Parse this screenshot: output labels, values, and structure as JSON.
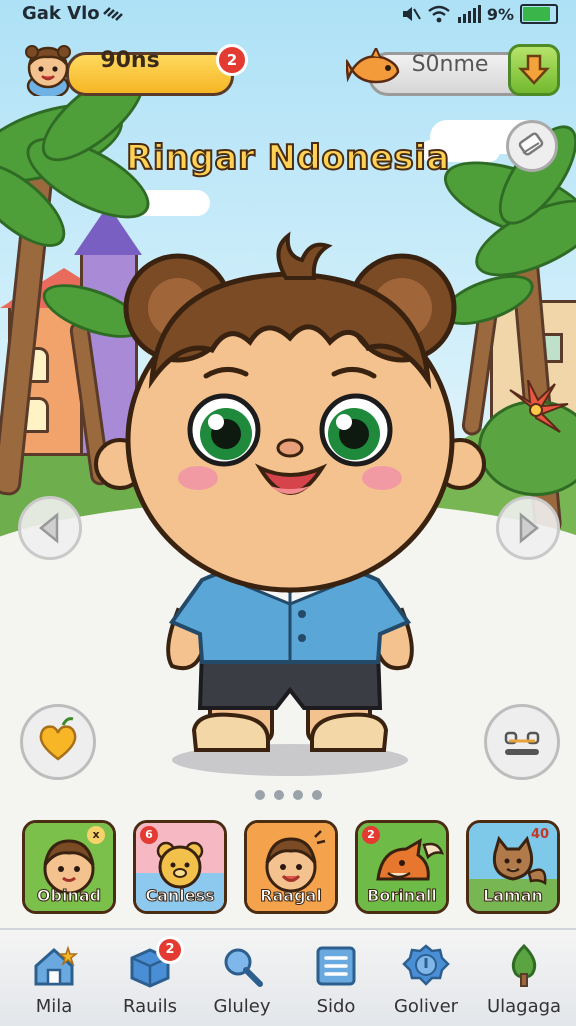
{
  "status_bar": {
    "app_label": "Gak Vlo",
    "battery_text": "9%",
    "battery_level": 0.9
  },
  "player": {
    "value": "90ns",
    "notification_count": "2"
  },
  "coins": {
    "value": "S0nme"
  },
  "title": "Ringar Ndonesia",
  "carousel": {
    "pages": 4,
    "active": 0
  },
  "colors": {
    "accent_yellow": "#f6b625",
    "accent_green": "#72b92f",
    "badge_red": "#e33a32"
  },
  "cards": [
    {
      "label": "Obinad",
      "icon": "boy-portrait",
      "badge": "x",
      "bg": "#7cc04c"
    },
    {
      "label": "Canless",
      "icon": "bear-portrait",
      "badge": "6",
      "bg": "#f6b9c4"
    },
    {
      "label": "Raagal",
      "icon": "boy-portrait",
      "badge": "",
      "bg": "#f4a24b"
    },
    {
      "label": "Borinall",
      "icon": "fox-portrait",
      "badge": "2",
      "bg": "#6fbb48"
    },
    {
      "label": "Laman",
      "icon": "cat-portrait",
      "badge": "40",
      "bg": "#7ec9e9"
    }
  ],
  "tabs": [
    {
      "label": "Mila",
      "icon": "home-icon"
    },
    {
      "label": "Rauils",
      "icon": "cube-icon",
      "badge": "2"
    },
    {
      "label": "Gluley",
      "icon": "magnifier-icon"
    },
    {
      "label": "Sido",
      "icon": "list-icon"
    },
    {
      "label": "Goliver",
      "icon": "badge-icon"
    },
    {
      "label": "Ulagaga",
      "icon": "tree-icon"
    }
  ]
}
